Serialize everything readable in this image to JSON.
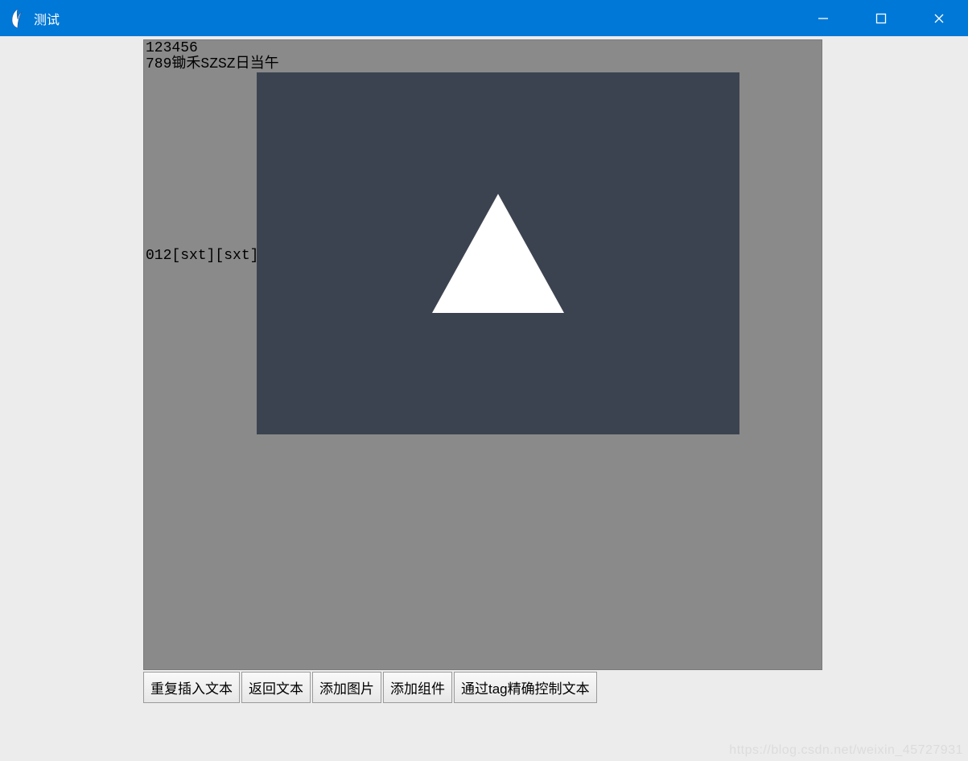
{
  "window": {
    "title": "测试"
  },
  "text": {
    "line1": "123456",
    "line2": "789锄禾SZSZ日当午",
    "line3": "012[sxt][sxt]"
  },
  "buttons": {
    "b1": "重复插入文本",
    "b2": "返回文本",
    "b3": "添加图片",
    "b4": "添加组件",
    "b5": "通过tag精确控制文本"
  },
  "watermark": "https://blog.csdn.net/weixin_45727931",
  "colors": {
    "titlebar": "#0078d7",
    "client_bg": "#ececec",
    "text_widget_bg": "#8a8a8a",
    "image_bg": "#3c4350"
  }
}
